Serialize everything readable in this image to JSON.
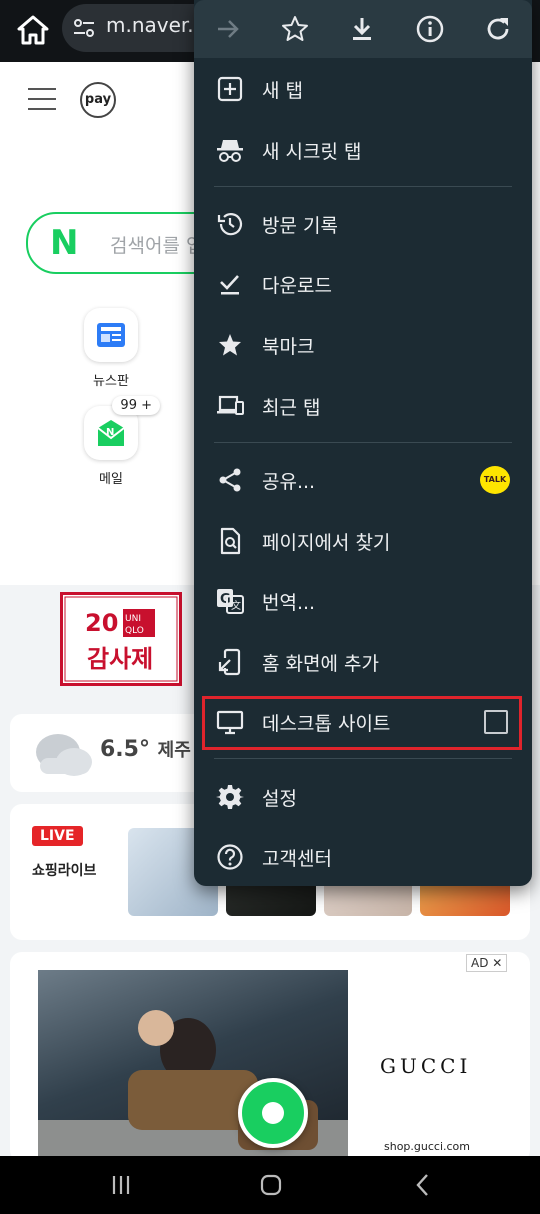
{
  "browser": {
    "url": "m.naver.c"
  },
  "page": {
    "pay_logo": "pay",
    "search_placeholder": "검색어를 입",
    "shortcuts": [
      {
        "label": "뉴스판"
      },
      {
        "label": "메일",
        "badge": "99 +"
      }
    ],
    "uniqlo_banner": {
      "line1": "20",
      "brand": "UNIQLO",
      "line2": "감사제"
    },
    "weather": {
      "temp": "6.5°",
      "location": "제주"
    },
    "live": {
      "badge": "LIVE",
      "label": "쇼핑라이브"
    },
    "ad": {
      "brand": "GUCCI",
      "url": "shop.gucci.com",
      "mark": "AD ✕"
    }
  },
  "menu": {
    "toolbar": [
      "forward-icon",
      "bookmark-star-icon",
      "download-icon",
      "info-icon",
      "refresh-icon"
    ],
    "items": [
      {
        "label": "새 탭"
      },
      {
        "label": "새 시크릿 탭"
      },
      {
        "label": "방문 기록"
      },
      {
        "label": "다운로드"
      },
      {
        "label": "북마크"
      },
      {
        "label": "최근 탭"
      },
      {
        "label": "공유..."
      },
      {
        "label": "페이지에서 찾기"
      },
      {
        "label": "번역..."
      },
      {
        "label": "홈 화면에 추가"
      },
      {
        "label": "데스크톱 사이트",
        "checked": false
      },
      {
        "label": "설정"
      },
      {
        "label": "고객센터"
      }
    ],
    "kakao_label": "TALK"
  },
  "colors": {
    "menu_bg": "#1c2b33",
    "naver_green": "#19ce60",
    "highlight_red": "#e0242c"
  }
}
